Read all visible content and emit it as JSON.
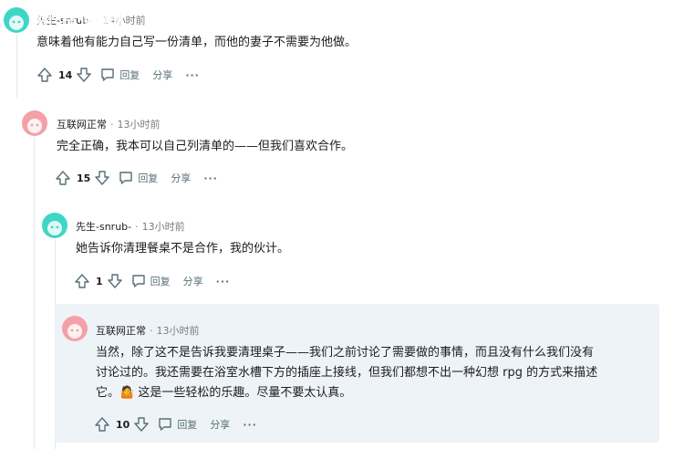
{
  "watermark": "新浪微博",
  "comments": [
    {
      "author": "先生-snrub-",
      "time": "14小时前",
      "body": "意味着他有能力自己写一份清单，而他的妻子不需要为他做。",
      "score": "14",
      "reply_label": "回复",
      "share_label": "分享",
      "more_label": "···",
      "avatar_color": "#3fd6c5"
    },
    {
      "author": "互联网正常",
      "time": "13小时前",
      "body": "完全正确，我本可以自己列清单的——但我们喜欢合作。",
      "score": "15",
      "reply_label": "回复",
      "share_label": "分享",
      "more_label": "···",
      "avatar_color": "#f4a0a8"
    },
    {
      "author": "先生-snrub-",
      "time": "13小时前",
      "body": "她告诉你清理餐桌不是合作，我的伙计。",
      "score": "1",
      "reply_label": "回复",
      "share_label": "分享",
      "more_label": "···",
      "avatar_color": "#3fd6c5"
    },
    {
      "author": "互联网正常",
      "time": "13小时前",
      "body_line1": "当然，除了这不是告诉我要清理桌子——我们之前讨论了需要做的事情，而且没有什么我们没有",
      "body_line2": "讨论过的。我还需要在浴室水槽下方的插座上接线，但我们都想不出一种幻想 rpg 的方式来描述",
      "body_line3": "它。🤷 这是一些轻松的乐趣。尽量不要太认真。",
      "score": "10",
      "reply_label": "回复",
      "share_label": "分享",
      "more_label": "···",
      "avatar_color": "#f4a0a8"
    }
  ]
}
